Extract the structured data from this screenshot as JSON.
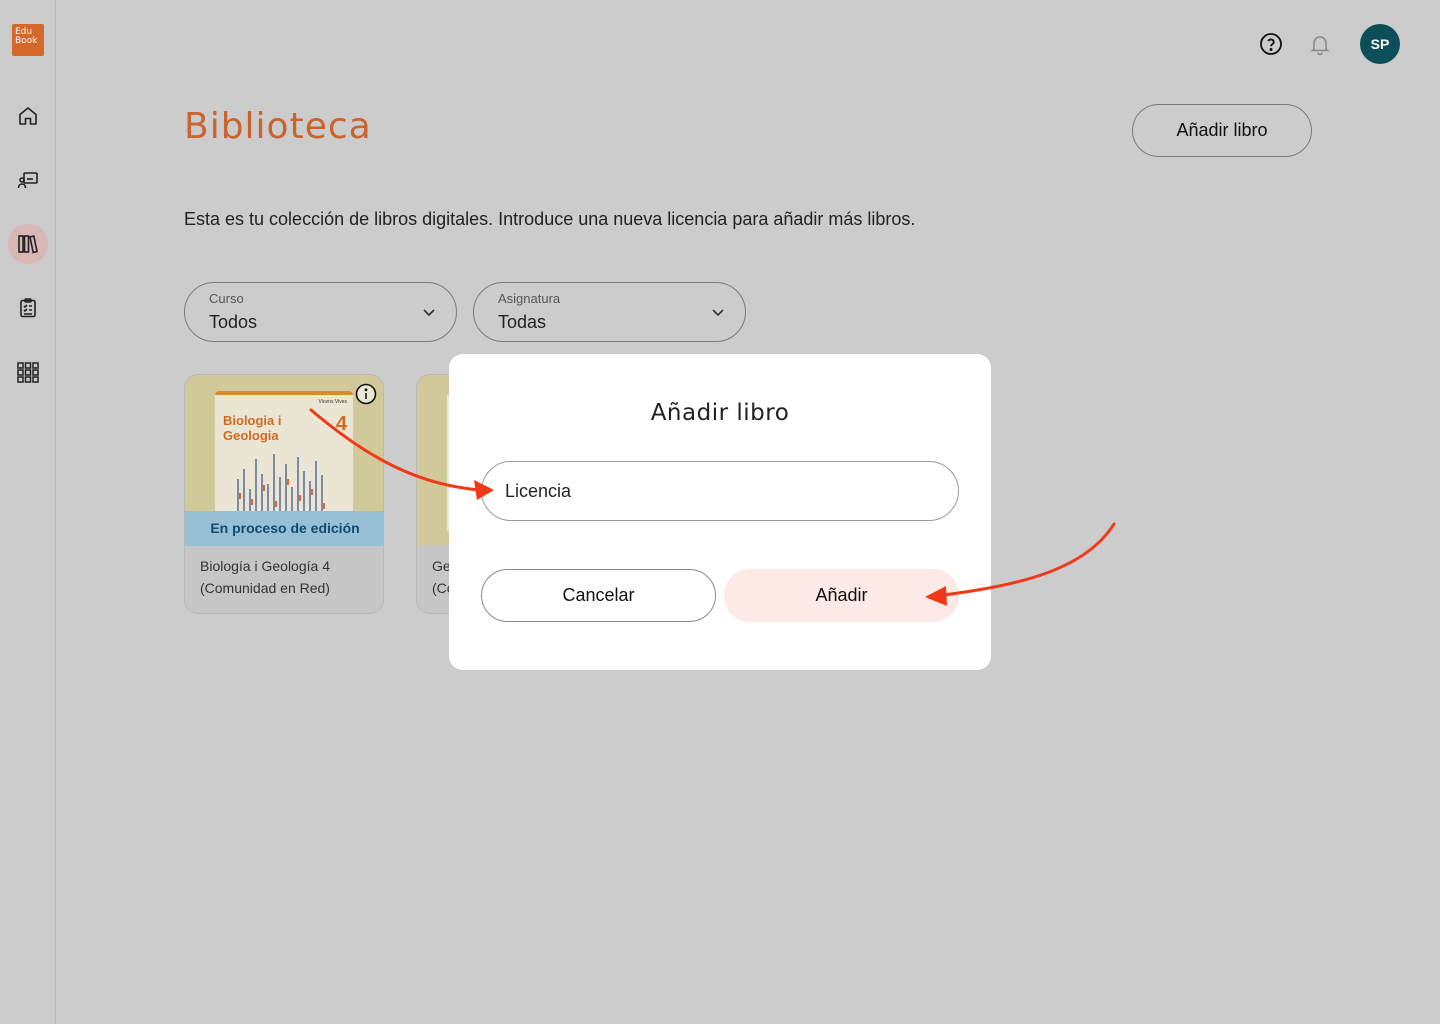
{
  "app": {
    "logo_text": "Edu Book"
  },
  "sidebar": {
    "items": [
      {
        "name": "home",
        "icon": "home-icon",
        "active": false
      },
      {
        "name": "classes",
        "icon": "presentation-icon",
        "active": false
      },
      {
        "name": "library",
        "icon": "books-icon",
        "active": true
      },
      {
        "name": "tasks",
        "icon": "clipboard-icon",
        "active": false
      },
      {
        "name": "apps",
        "icon": "grid-icon",
        "active": false
      }
    ]
  },
  "header": {
    "help_icon": "help-circle-icon",
    "notifications_icon": "bell-icon",
    "avatar_initials": "SP",
    "avatar_color": "#0d4f58"
  },
  "page": {
    "title": "Biblioteca",
    "title_color": "#c9642f",
    "add_book_label": "Añadir libro",
    "intro": "Esta es tu colección de libros digitales. Introduce una nueva licencia para añadir más libros."
  },
  "filters": {
    "course": {
      "label": "Curso",
      "value": "Todos"
    },
    "subject": {
      "label": "Asignatura",
      "value": "Todas"
    }
  },
  "books": [
    {
      "cover_title_line1": "Biologia i",
      "cover_title_line2": "Geologia",
      "cover_number": "4",
      "cover_brand": "Vicens Vives",
      "status": "En proceso de edición",
      "name_line1": "Biología i Geología 4",
      "name_line2": "(Comunidad en Red)"
    },
    {
      "name_line1": "Ge",
      "name_line2": "(Co"
    }
  ],
  "modal": {
    "title": "Añadir libro",
    "input_placeholder": "Licencia",
    "input_value": "",
    "cancel_label": "Cancelar",
    "add_label": "Añadir",
    "add_button_color": "#fde9e6"
  },
  "annotation_color": "#f03a17"
}
